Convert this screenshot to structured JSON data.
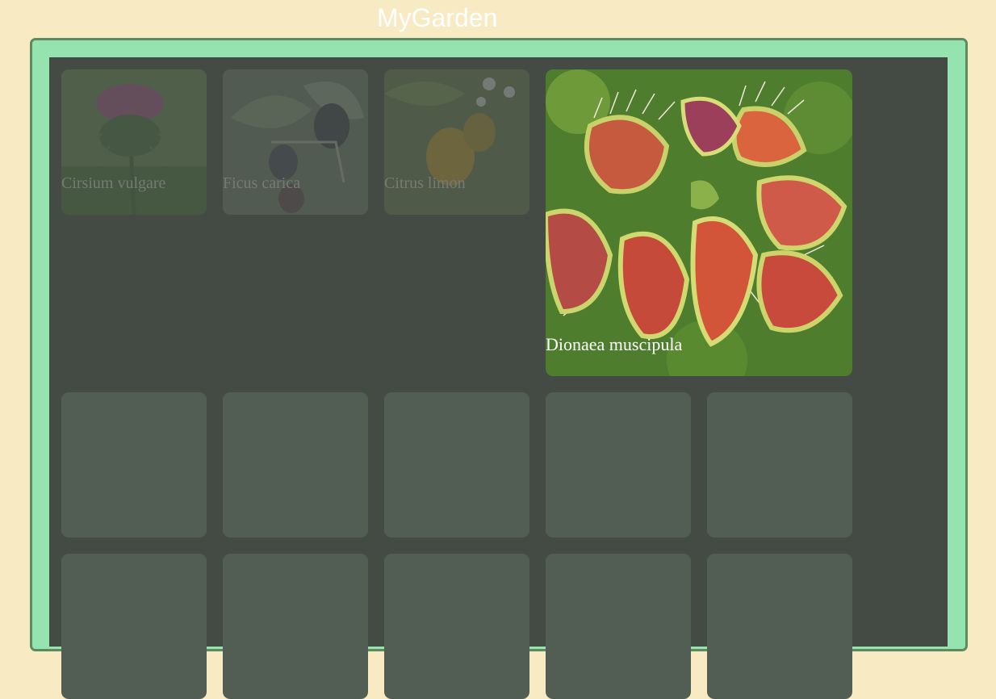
{
  "app": {
    "title": "MyGarden"
  },
  "garden": {
    "plants": [
      {
        "name": "Cirsium vulgare",
        "state": "dimmed"
      },
      {
        "name": "Ficus carica",
        "state": "dimmed"
      },
      {
        "name": "Citrus limon",
        "state": "dimmed"
      },
      {
        "name": "Dionaea muscipula",
        "state": "selected"
      }
    ],
    "empty_slots": 10
  },
  "colors": {
    "page_bg": "#f8ebc4",
    "frame": "#95e4b0",
    "board": "#444b45",
    "empty_slot": "#525e53"
  }
}
